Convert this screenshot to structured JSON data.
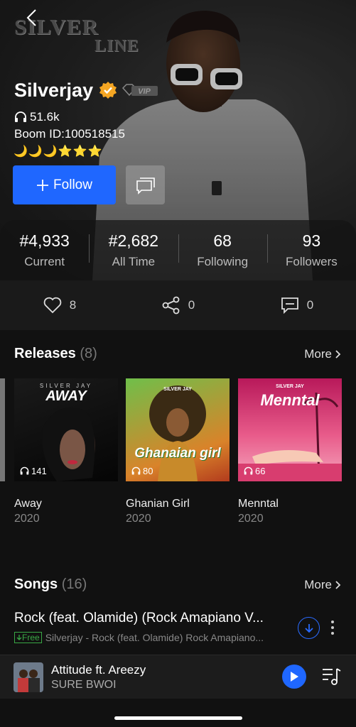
{
  "header": {
    "logo_line1": "SILVER",
    "logo_line2": "LINE",
    "artist_name": "Silverjay",
    "vip_label": "VIP",
    "listen_count": "51.6k",
    "boom_id": "Boom ID:100518515",
    "level_icons": "🌙🌙🌙⭐⭐⭐",
    "follow_label": "Follow"
  },
  "stats": [
    {
      "value": "#4,933",
      "label": "Current"
    },
    {
      "value": "#2,682",
      "label": "All Time"
    },
    {
      "value": "68",
      "label": "Following"
    },
    {
      "value": "93",
      "label": "Followers"
    }
  ],
  "actions": {
    "likes": "8",
    "shares": "0",
    "comments": "0"
  },
  "releases": {
    "title": "Releases",
    "count": "(8)",
    "more_label": "More",
    "items": [
      {
        "cover_text": "AWAY",
        "artist": "SILVER JAY",
        "plays": "141",
        "title": "Away",
        "year": "2020"
      },
      {
        "cover_text": "Ghanaian girl",
        "artist": "SILVER JAY",
        "plays": "80",
        "title": "Ghanian Girl",
        "year": "2020"
      },
      {
        "cover_text": "Menntal",
        "artist": "SILVER JAY",
        "plays": "66",
        "title": "Menntal",
        "year": "2020"
      }
    ]
  },
  "songs": {
    "title": "Songs",
    "count": "(16)",
    "more_label": "More",
    "items": [
      {
        "title": "Rock (feat. Olamide) (Rock Amapiano V...",
        "badge": "Free",
        "subtitle": "Silverjay - Rock (feat. Olamide) Rock Amapiano..."
      }
    ]
  },
  "player": {
    "title": "Attitude ft. Areezy",
    "artist": "SURE BWOI"
  },
  "colors": {
    "accent": "#1f67ff",
    "verified": "#f5a623",
    "free": "#39a845"
  }
}
